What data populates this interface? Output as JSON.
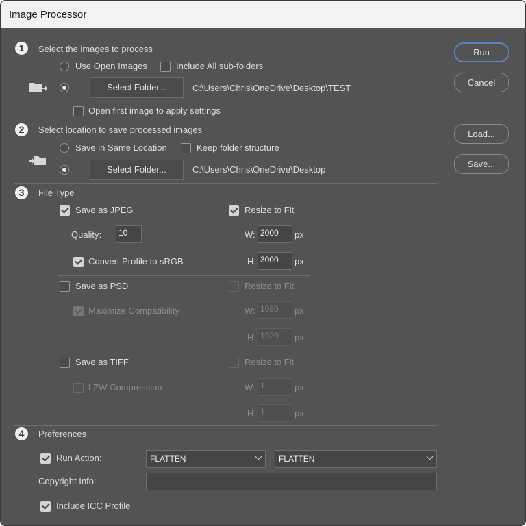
{
  "window": {
    "title": "Image Processor"
  },
  "section1": {
    "number": "1",
    "heading": "Select the images to process",
    "use_open_images": "Use Open Images",
    "include_subfolders": "Include All sub-folders",
    "select_folder": "Select Folder...",
    "folder_path": "C:\\Users\\Chris\\OneDrive\\Desktop\\TEST",
    "open_first_image": "Open first image to apply settings",
    "icon": "folder-open-arrow-icon"
  },
  "section2": {
    "number": "2",
    "heading": "Select location to save processed images",
    "save_same_location": "Save in Same Location",
    "keep_folder_structure": "Keep folder structure",
    "select_folder": "Select Folder...",
    "folder_path": "C:\\Users\\Chris\\OneDrive\\Desktop",
    "icon": "save-to-folder-icon"
  },
  "section3": {
    "number": "3",
    "heading": "File Type",
    "jpeg": {
      "save_label": "Save as JPEG",
      "resize_label": "Resize to Fit",
      "quality_label": "Quality:",
      "quality_value": "10",
      "w_label": "W:",
      "w_value": "2000",
      "h_label": "H:",
      "h_value": "3000",
      "unit": "px",
      "convert_label": "Convert Profile to sRGB"
    },
    "psd": {
      "save_label": "Save as PSD",
      "resize_label": "Resize to Fit",
      "maximize_label": "Maximize Compatibility",
      "w_label": "W:",
      "w_value": "1080",
      "h_label": "H:",
      "h_value": "1920",
      "unit": "px"
    },
    "tiff": {
      "save_label": "Save as TIFF",
      "resize_label": "Resize to Fit",
      "lzw_label": "LZW Compression",
      "w_label": "W:",
      "w_value": "1",
      "h_label": "H:",
      "h_value": "1",
      "unit": "px"
    }
  },
  "section4": {
    "number": "4",
    "heading": "Preferences",
    "run_action_label": "Run Action:",
    "action_set": "FLATTEN",
    "action": "FLATTEN",
    "copyright_label": "Copyright Info:",
    "copyright_value": "",
    "icc_label": "Include ICC Profile"
  },
  "buttons": {
    "run": "Run",
    "cancel": "Cancel",
    "load": "Load...",
    "save": "Save..."
  }
}
